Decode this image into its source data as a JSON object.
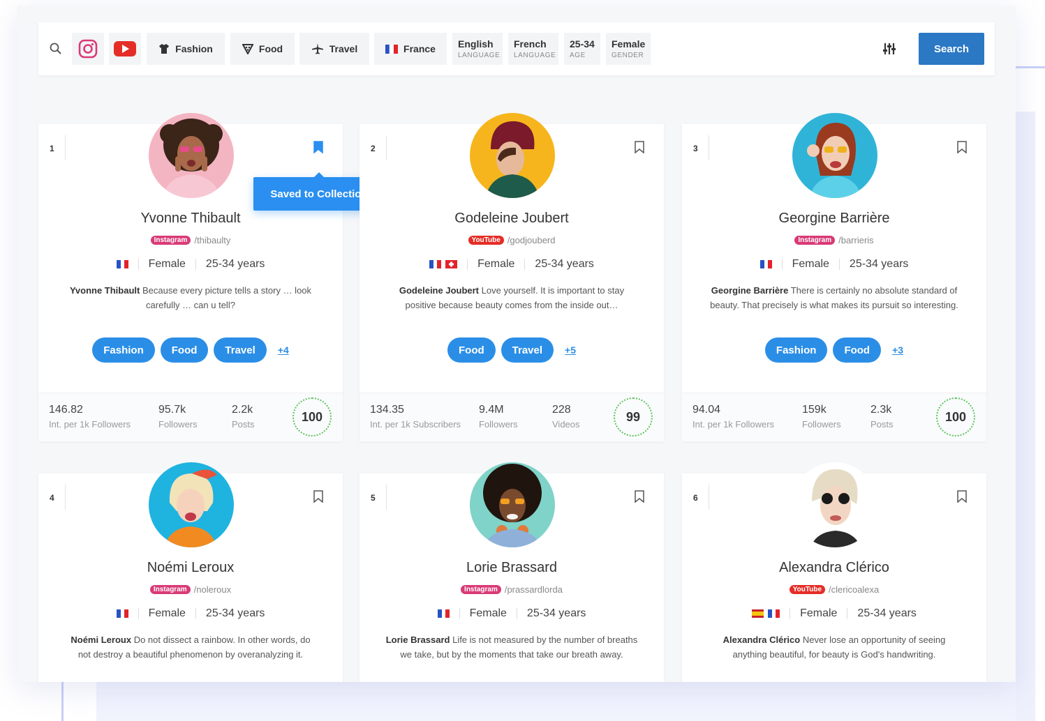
{
  "toolbar": {
    "filters": {
      "fashion": "Fashion",
      "food": "Food",
      "travel": "Travel",
      "france": "France"
    },
    "facets": [
      {
        "value": "English",
        "label": "LANGUAGE"
      },
      {
        "value": "French",
        "label": "LANGUAGE"
      },
      {
        "value": "25-34",
        "label": "AGE"
      },
      {
        "value": "Female",
        "label": "GENDER"
      }
    ],
    "search_label": "Search"
  },
  "colors": {
    "accent": "#2b8ee6",
    "search_button": "#2b78c4",
    "instagram_badge": "#d93a76",
    "youtube_badge": "#e52d27",
    "score_ring": "#5cc35c"
  },
  "tooltip": "Saved to Collection",
  "cards": [
    {
      "rank": "1",
      "name": "Yvonne Thibault",
      "platform": "Instagram",
      "handle": "/thibaulty",
      "flags": [
        "fr"
      ],
      "gender": "Female",
      "age": "25-34 years",
      "bio_name": "Yvonne Thibault",
      "bio": "Because every picture tells a story … look carefully … can u tell?",
      "tags": [
        "Fashion",
        "Food",
        "Travel"
      ],
      "more": "+4",
      "stats": [
        {
          "n": "146.82",
          "l": "Int. per 1k Followers"
        },
        {
          "n": "95.7k",
          "l": "Followers"
        },
        {
          "n": "2.2k",
          "l": "Posts"
        }
      ],
      "score": "100",
      "saved": true,
      "avatar_icon": "avatar-curly-hair-pink"
    },
    {
      "rank": "2",
      "name": "Godeleine Joubert",
      "platform": "YouTube",
      "handle": "/godjouberd",
      "flags": [
        "fr",
        "ch"
      ],
      "gender": "Female",
      "age": "25-34 years",
      "bio_name": "Godeleine Joubert",
      "bio": "Love yourself. It is important to stay positive because beauty comes from the inside out…",
      "tags": [
        "Food",
        "Travel"
      ],
      "more": "+5",
      "stats": [
        {
          "n": "134.35",
          "l": "Int. per 1k Subscribers"
        },
        {
          "n": "9.4M",
          "l": "Followers"
        },
        {
          "n": "228",
          "l": "Videos"
        }
      ],
      "score": "99",
      "saved": false,
      "avatar_icon": "avatar-beanie-yellow"
    },
    {
      "rank": "3",
      "name": "Georgine Barrière",
      "platform": "Instagram",
      "handle": "/barrieris",
      "flags": [
        "fr"
      ],
      "gender": "Female",
      "age": "25-34 years",
      "bio_name": "Georgine Barrière",
      "bio": "There is certainly no absolute standard of beauty. That precisely is what makes its pursuit so interesting.",
      "tags": [
        "Fashion",
        "Food"
      ],
      "more": "+3",
      "stats": [
        {
          "n": "94.04",
          "l": "Int. per 1k Followers"
        },
        {
          "n": "159k",
          "l": "Followers"
        },
        {
          "n": "2.3k",
          "l": "Posts"
        }
      ],
      "score": "100",
      "saved": false,
      "avatar_icon": "avatar-sunglasses-blue"
    },
    {
      "rank": "4",
      "name": "Noémi Leroux",
      "platform": "Instagram",
      "handle": "/noleroux",
      "flags": [
        "fr"
      ],
      "gender": "Female",
      "age": "25-34 years",
      "bio_name": "Noémi Leroux",
      "bio": "Do not dissect a rainbow. In other words, do not destroy a beautiful phenomenon by overanalyzing it.",
      "tags": [],
      "more": "",
      "stats": [],
      "score": "",
      "saved": false,
      "avatar_icon": "avatar-blonde-bow"
    },
    {
      "rank": "5",
      "name": "Lorie Brassard",
      "platform": "Instagram",
      "handle": "/prassardlorda",
      "flags": [
        "fr"
      ],
      "gender": "Female",
      "age": "25-34 years",
      "bio_name": "Lorie Brassard",
      "bio": "Life is not measured by the number of breaths we take, but by the moments that take our breath away.",
      "tags": [],
      "more": "",
      "stats": [],
      "score": "",
      "saved": false,
      "avatar_icon": "avatar-afro-headphones"
    },
    {
      "rank": "6",
      "name": "Alexandra Clérico",
      "platform": "YouTube",
      "handle": "/clericoalexa",
      "flags": [
        "es",
        "fr"
      ],
      "gender": "Female",
      "age": "25-34 years",
      "bio_name": "Alexandra Clérico",
      "bio": "Never lose an opportunity of seeing anything beautiful, for beauty is God's handwriting.",
      "tags": [],
      "more": "",
      "stats": [],
      "score": "",
      "saved": false,
      "avatar_icon": "avatar-sunglasses-white"
    }
  ]
}
